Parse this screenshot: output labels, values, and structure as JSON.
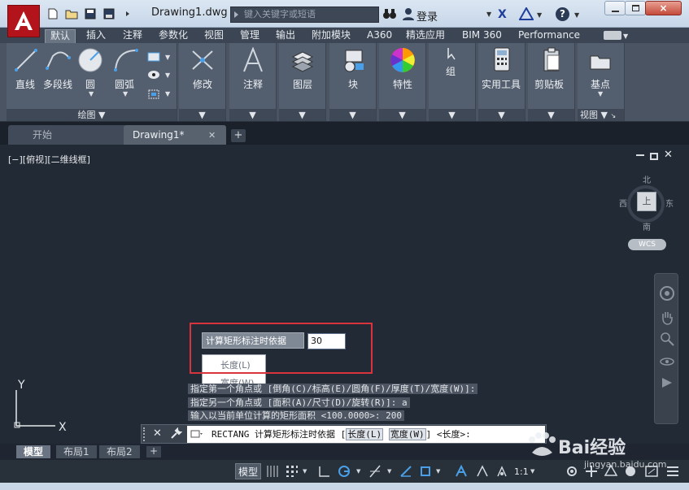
{
  "titlebar": {
    "doc_title": "Drawing1.dwg",
    "search_placeholder": "键入关键字或短语",
    "login_label": "登录",
    "close_symbol": "×",
    "help_symbol": "?"
  },
  "ribbon_tabs": [
    "默认",
    "插入",
    "注释",
    "参数化",
    "视图",
    "管理",
    "输出",
    "附加模块",
    "A360",
    "精选应用",
    "BIM 360",
    "Performance"
  ],
  "ribbon": {
    "draw_panel": {
      "title": "绘图",
      "tools": [
        "直线",
        "多段线",
        "圆",
        "圆弧"
      ]
    },
    "modify_label": "修改",
    "annotate_label": "注释",
    "layers_label": "图层",
    "block_label": "块",
    "properties_label": "特性",
    "group_label": "组",
    "utilities_label": "实用工具",
    "clipboard_label": "剪贴板",
    "view_panel": {
      "basepoint_label": "基点",
      "title": "视图"
    }
  },
  "doc_tabs": {
    "start": "开始",
    "drawing": "Drawing1*",
    "add_symbol": "+"
  },
  "viewport": {
    "label": "[−][俯视][二维线框]",
    "cube_top": "上",
    "north": "北",
    "south": "南",
    "east": "东",
    "west": "西",
    "wcs": "WCS"
  },
  "ucs": {
    "x_label": "X",
    "y_label": "Y"
  },
  "dynamic_input": {
    "label": "计算矩形标注时依据",
    "value": "30",
    "options": [
      "长度(L)",
      "宽度(W)"
    ]
  },
  "command_history": [
    "指定第一个角点或 [倒角(C)/标高(E)/圆角(F)/厚度(T)/宽度(W)]:",
    "指定另一个角点或 [面积(A)/尺寸(D)/旋转(R)]: a",
    "输入以当前单位计算的矩形面积 <100.0000>:  200"
  ],
  "command_line": {
    "prefix": "RECTANG 计算矩形标注时依据 [",
    "option1": "长度(L)",
    "option2": "宽度(W)",
    "suffix": "] <长度>:"
  },
  "layout_tabs": [
    "模型",
    "布局1",
    "布局2"
  ],
  "status_bar": {
    "model": "模型",
    "scale": "1:1"
  },
  "watermark": {
    "logo_text": "Bai经验",
    "url": "jingyan.baidu.com"
  },
  "colors": {
    "accent_red": "#d9343e",
    "canvas": "#222a35",
    "ribbon": "#535e6e",
    "logo_red": "#b3141b"
  }
}
